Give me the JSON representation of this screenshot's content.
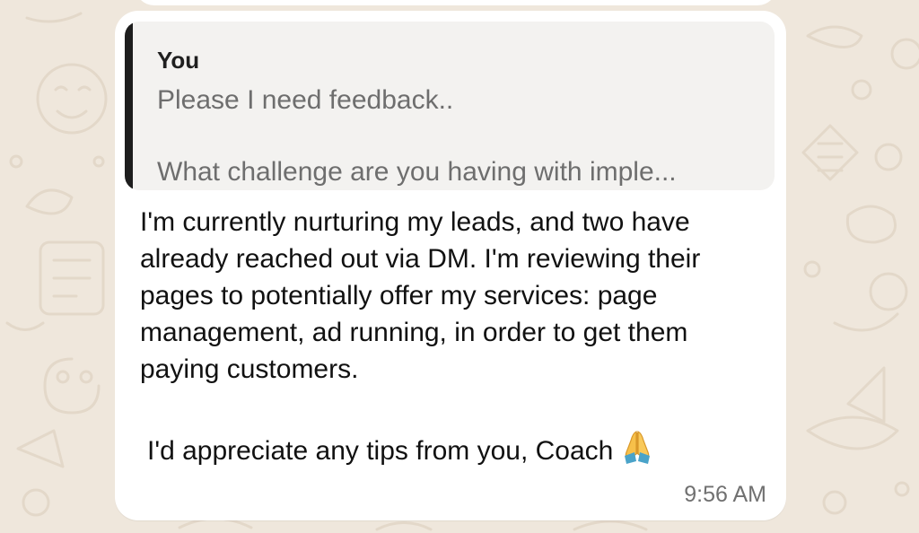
{
  "quoted_message": {
    "author": "You",
    "line_1": "Please I need feedback..",
    "line_2": "What challenge are you having with imple..."
  },
  "message": {
    "lines": [
      "I'm currently nurturing my leads, and two have",
      "already reached out via DM. I'm reviewing their",
      "pages to potentially offer my services: page",
      "management, ad running, in order to get them",
      "paying customers."
    ],
    "closing": "I'd appreciate any tips from you, Coach",
    "emoji": "folded-hands-icon",
    "time": "9:56 AM"
  },
  "colors": {
    "wallpaper": "#efe7dc",
    "bubble": "#ffffff",
    "quote_background": "#f3f2f0",
    "quote_bar": "#1d1d1d",
    "quote_text": "#6e6e6e",
    "message_text": "#111111",
    "timestamp": "#707070"
  }
}
